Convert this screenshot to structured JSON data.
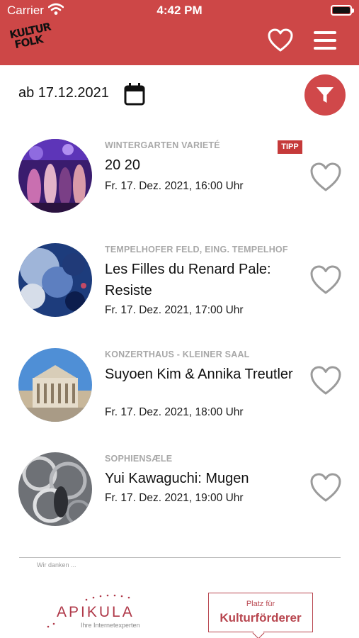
{
  "status_bar": {
    "carrier": "Carrier",
    "time": "4:42 PM"
  },
  "header": {
    "logo_line1": "KULTUR",
    "logo_line2": "FOLK",
    "icons": [
      "heart-icon",
      "menu-icon"
    ]
  },
  "filter": {
    "date_label": "ab 17.12.2021",
    "icons": [
      "calendar-icon",
      "filter-icon"
    ]
  },
  "events": [
    {
      "venue": "WINTERGARTEN VARIETÉ",
      "title": "20 20",
      "when": "Fr. 17. Dez. 2021, 16:00 Uhr",
      "badge": "TIPP"
    },
    {
      "venue": "TEMPELHOFER FELD, EING. TEMPELHOF",
      "title": "Les Filles du Renard Pale: Resiste",
      "when": "Fr. 17. Dez. 2021, 17:00 Uhr"
    },
    {
      "venue": "KONZERTHAUS - KLEINER SAAL",
      "title": "Suyoen Kim & Annika Treutler",
      "when": "Fr. 17. Dez. 2021, 18:00 Uhr"
    },
    {
      "venue": "SOPHIENSÆLE",
      "title": "Yui Kawaguchi: Mugen",
      "when": "Fr. 17. Dez. 2021, 19:00 Uhr"
    }
  ],
  "footer": {
    "thanks": "Wir danken ...",
    "sponsor1_name": "APIKULA",
    "sponsor1_tagline": "Ihre Internetexperten",
    "sponsor2_line1": "Platz für",
    "sponsor2_line2": "Kulturförderer"
  },
  "colors": {
    "brand": "#cd4747",
    "badge": "#c53a3a",
    "muted": "#a8a8a8"
  }
}
